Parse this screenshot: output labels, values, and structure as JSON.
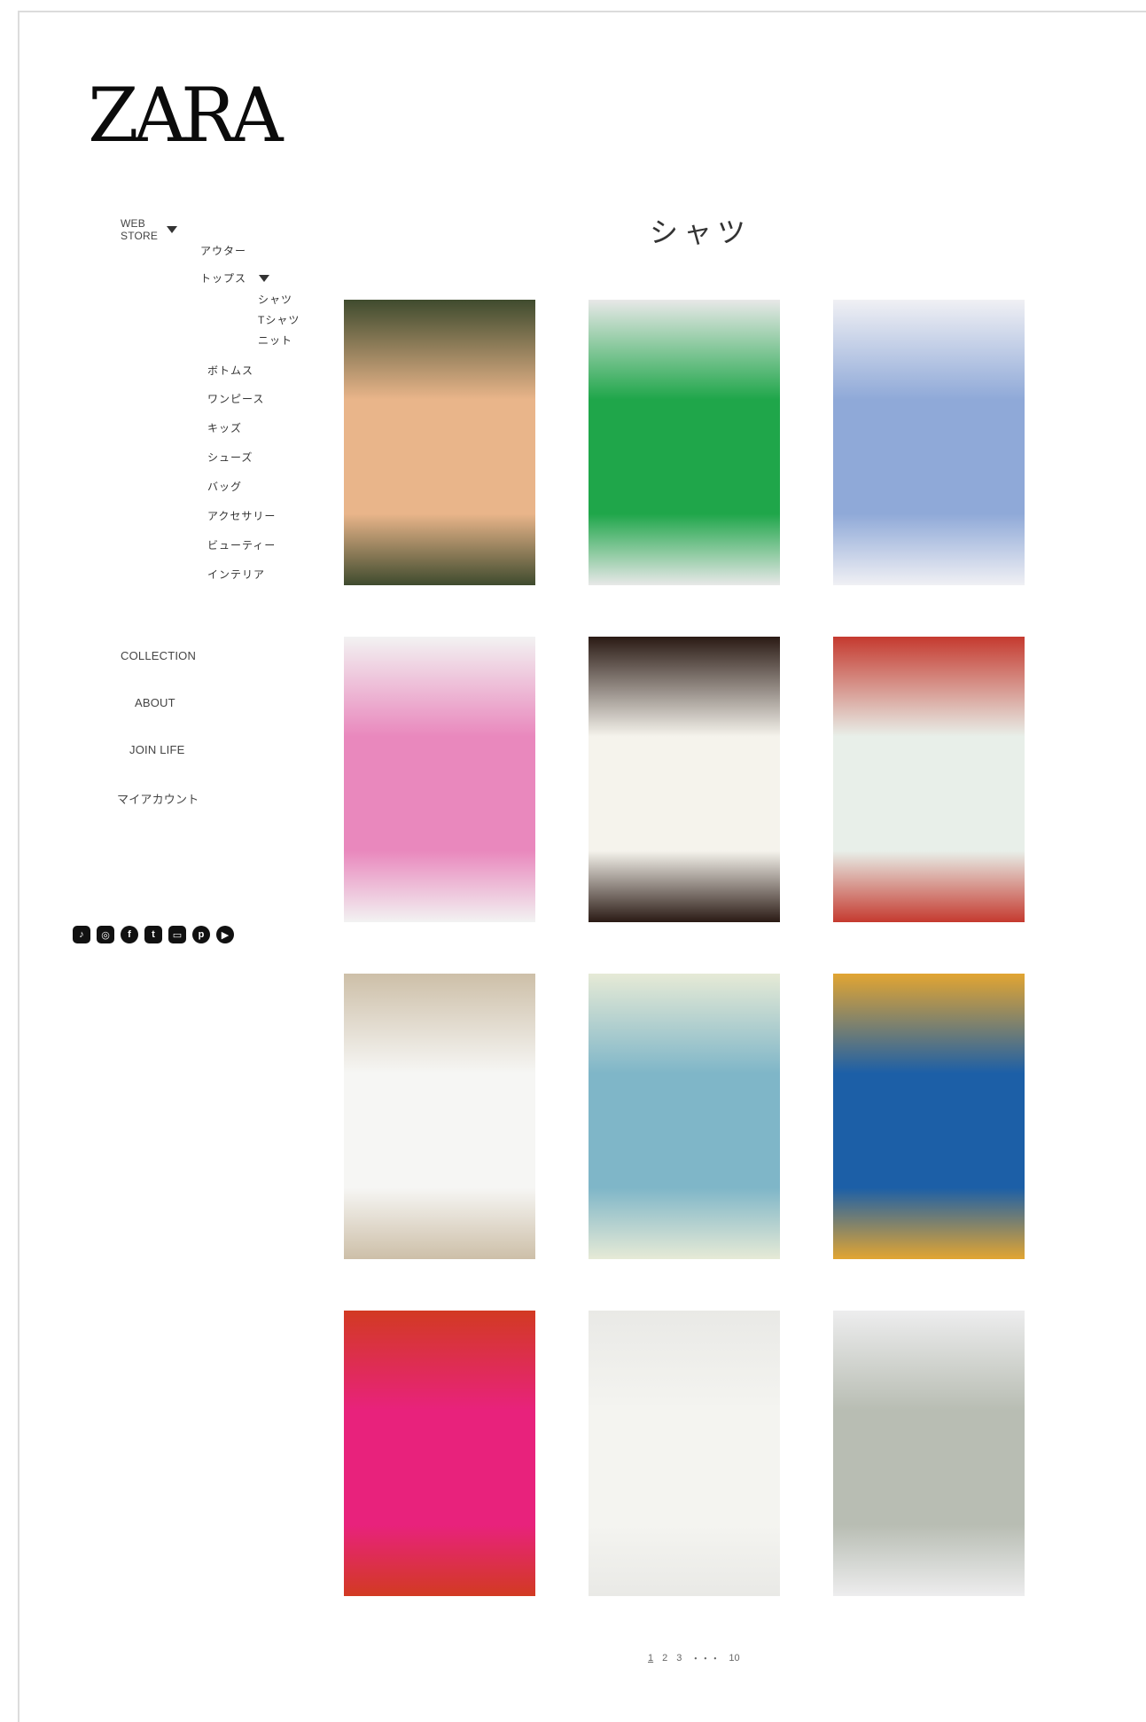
{
  "brand": {
    "logo": "ZARA"
  },
  "sidebar": {
    "web_store": "WEB STORE",
    "categories": [
      {
        "label": "アウター"
      },
      {
        "label": "トップス"
      },
      {
        "label": "ボトムス"
      },
      {
        "label": "ワンピース"
      },
      {
        "label": "キッズ"
      },
      {
        "label": "シューズ"
      },
      {
        "label": "バッグ"
      },
      {
        "label": "アクセサリー"
      },
      {
        "label": "ビューティー"
      },
      {
        "label": "インテリア"
      }
    ],
    "tops_sub": [
      {
        "label": "シャツ"
      },
      {
        "label": "Tシャツ"
      },
      {
        "label": "ニット"
      }
    ],
    "main_nav": [
      {
        "label": "COLLECTION"
      },
      {
        "label": "ABOUT"
      },
      {
        "label": "JOIN LIFE"
      },
      {
        "label": "マイアカウント"
      }
    ],
    "social_icons": [
      "tiktok-icon",
      "instagram-icon",
      "facebook-icon",
      "twitter-icon",
      "line-icon",
      "pinterest-icon",
      "youtube-icon"
    ]
  },
  "main": {
    "title": "シャツ",
    "products": [
      {
        "colors": [
          "#e9b58a",
          "#3f4b2e"
        ]
      },
      {
        "colors": [
          "#1fa64a",
          "#e8e8e8"
        ]
      },
      {
        "colors": [
          "#8fa9d8",
          "#f0f0f4"
        ]
      },
      {
        "colors": [
          "#e988bd",
          "#f2f2f2"
        ]
      },
      {
        "colors": [
          "#f5f3ec",
          "#2a1a14"
        ]
      },
      {
        "colors": [
          "#e8efe9",
          "#c53a2f"
        ]
      },
      {
        "colors": [
          "#f6f6f4",
          "#cdbfa8"
        ]
      },
      {
        "colors": [
          "#7fb6c8",
          "#e6ead6"
        ]
      },
      {
        "colors": [
          "#1c5fa7",
          "#e2a532"
        ]
      },
      {
        "colors": [
          "#e8227c",
          "#d23a22"
        ]
      },
      {
        "colors": [
          "#f4f4f0",
          "#e9e9e6"
        ]
      },
      {
        "colors": [
          "#b8bdb3",
          "#ededee"
        ]
      }
    ]
  },
  "pagination": {
    "pages": [
      "1",
      "2",
      "3",
      "・・・",
      "10"
    ],
    "current": "1"
  }
}
